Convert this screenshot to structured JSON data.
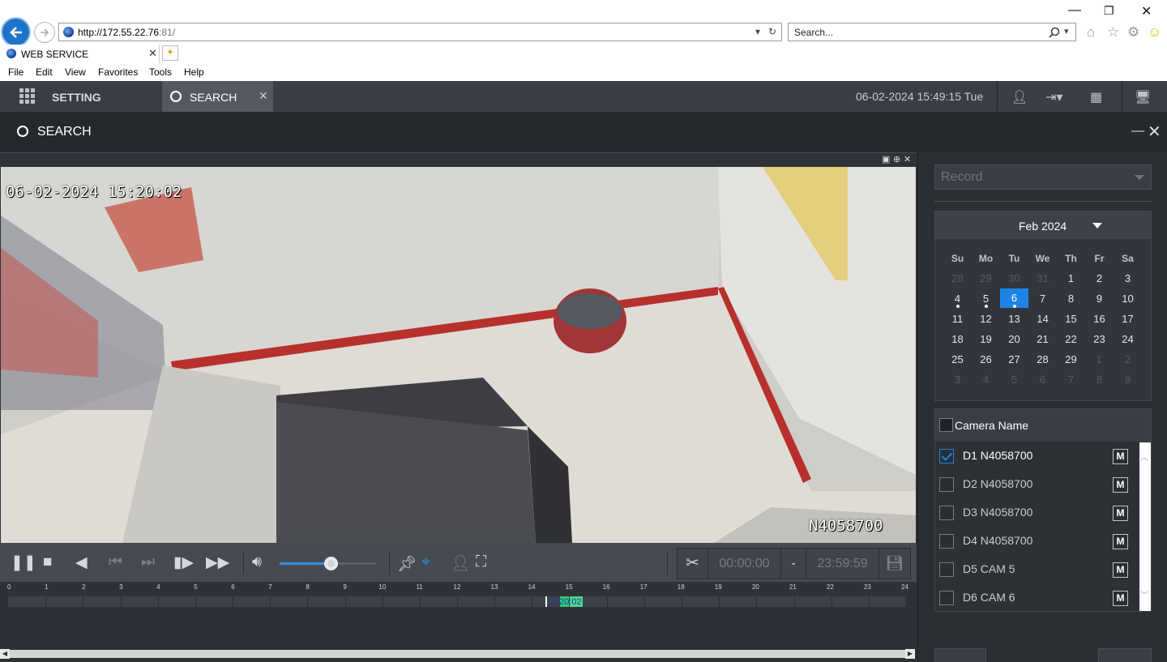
{
  "browser": {
    "url_host": "http://172.55.22.76",
    "url_port": ":81/",
    "search_placeholder": "Search...",
    "tab_title": "WEB SERVICE",
    "menu": [
      "File",
      "Edit",
      "View",
      "Favorites",
      "Tools",
      "Help"
    ]
  },
  "app": {
    "tabs": [
      {
        "label": "SETTING",
        "active": false
      },
      {
        "label": "SEARCH",
        "active": true
      }
    ],
    "datetime": "06-02-2024 15:49:15 Tue",
    "section_title": "SEARCH"
  },
  "player": {
    "osd_time": "06-02-2024 15:20:02",
    "osd_camera": "N4058700",
    "volume_level": 0.53,
    "clip_start": "00:00:00",
    "clip_sep": "-",
    "clip_end": "23:59:59",
    "timeline": {
      "hours": [
        "0",
        "1",
        "2",
        "3",
        "4",
        "5",
        "6",
        "7",
        "8",
        "9",
        "10",
        "11",
        "12",
        "13",
        "14",
        "15",
        "16",
        "17",
        "18",
        "19",
        "20",
        "21",
        "22",
        "23",
        "24"
      ],
      "record_hours": [
        [
          14.75,
          15.0
        ],
        [
          15.0,
          15.35
        ]
      ],
      "cursor_label": "15:20:02",
      "cursor_hour": 15.33
    }
  },
  "panel": {
    "record_type": "Record",
    "calendar": {
      "month_label": "Feb 2024",
      "weekdays": [
        "Su",
        "Mo",
        "Tu",
        "We",
        "Th",
        "Fr",
        "Sa"
      ],
      "days": [
        {
          "n": "28",
          "other": true
        },
        {
          "n": "29",
          "other": true
        },
        {
          "n": "30",
          "other": true
        },
        {
          "n": "31",
          "other": true
        },
        {
          "n": "1"
        },
        {
          "n": "2"
        },
        {
          "n": "3"
        },
        {
          "n": "4",
          "dot": true
        },
        {
          "n": "5",
          "dot": true
        },
        {
          "n": "6",
          "dot": true,
          "selected": true
        },
        {
          "n": "7"
        },
        {
          "n": "8"
        },
        {
          "n": "9"
        },
        {
          "n": "10"
        },
        {
          "n": "11"
        },
        {
          "n": "12"
        },
        {
          "n": "13"
        },
        {
          "n": "14"
        },
        {
          "n": "15"
        },
        {
          "n": "16"
        },
        {
          "n": "17"
        },
        {
          "n": "18"
        },
        {
          "n": "19"
        },
        {
          "n": "20"
        },
        {
          "n": "21"
        },
        {
          "n": "22"
        },
        {
          "n": "23"
        },
        {
          "n": "24"
        },
        {
          "n": "25"
        },
        {
          "n": "26"
        },
        {
          "n": "27"
        },
        {
          "n": "28"
        },
        {
          "n": "29"
        },
        {
          "n": "1",
          "other": true
        },
        {
          "n": "2",
          "other": true
        },
        {
          "n": "3",
          "other": true
        },
        {
          "n": "4",
          "other": true
        },
        {
          "n": "5",
          "other": true
        },
        {
          "n": "6",
          "other": true
        },
        {
          "n": "7",
          "other": true
        },
        {
          "n": "8",
          "other": true
        },
        {
          "n": "9",
          "other": true
        }
      ]
    },
    "camera_header": "Camera Name",
    "cameras": [
      {
        "name": "D1 N4058700",
        "checked": true,
        "m": "M"
      },
      {
        "name": "D2 N4058700",
        "checked": false,
        "m": "M"
      },
      {
        "name": "D3 N4058700",
        "checked": false,
        "m": "M"
      },
      {
        "name": "D4 N4058700",
        "checked": false,
        "m": "M"
      },
      {
        "name": "D5 CAM 5",
        "checked": false,
        "m": "M"
      },
      {
        "name": "D6 CAM 6",
        "checked": false,
        "m": "M"
      }
    ]
  },
  "colors": {
    "accent": "#1c84e4",
    "record_green": "#2ecc71",
    "topbar": "#3a3e44"
  }
}
